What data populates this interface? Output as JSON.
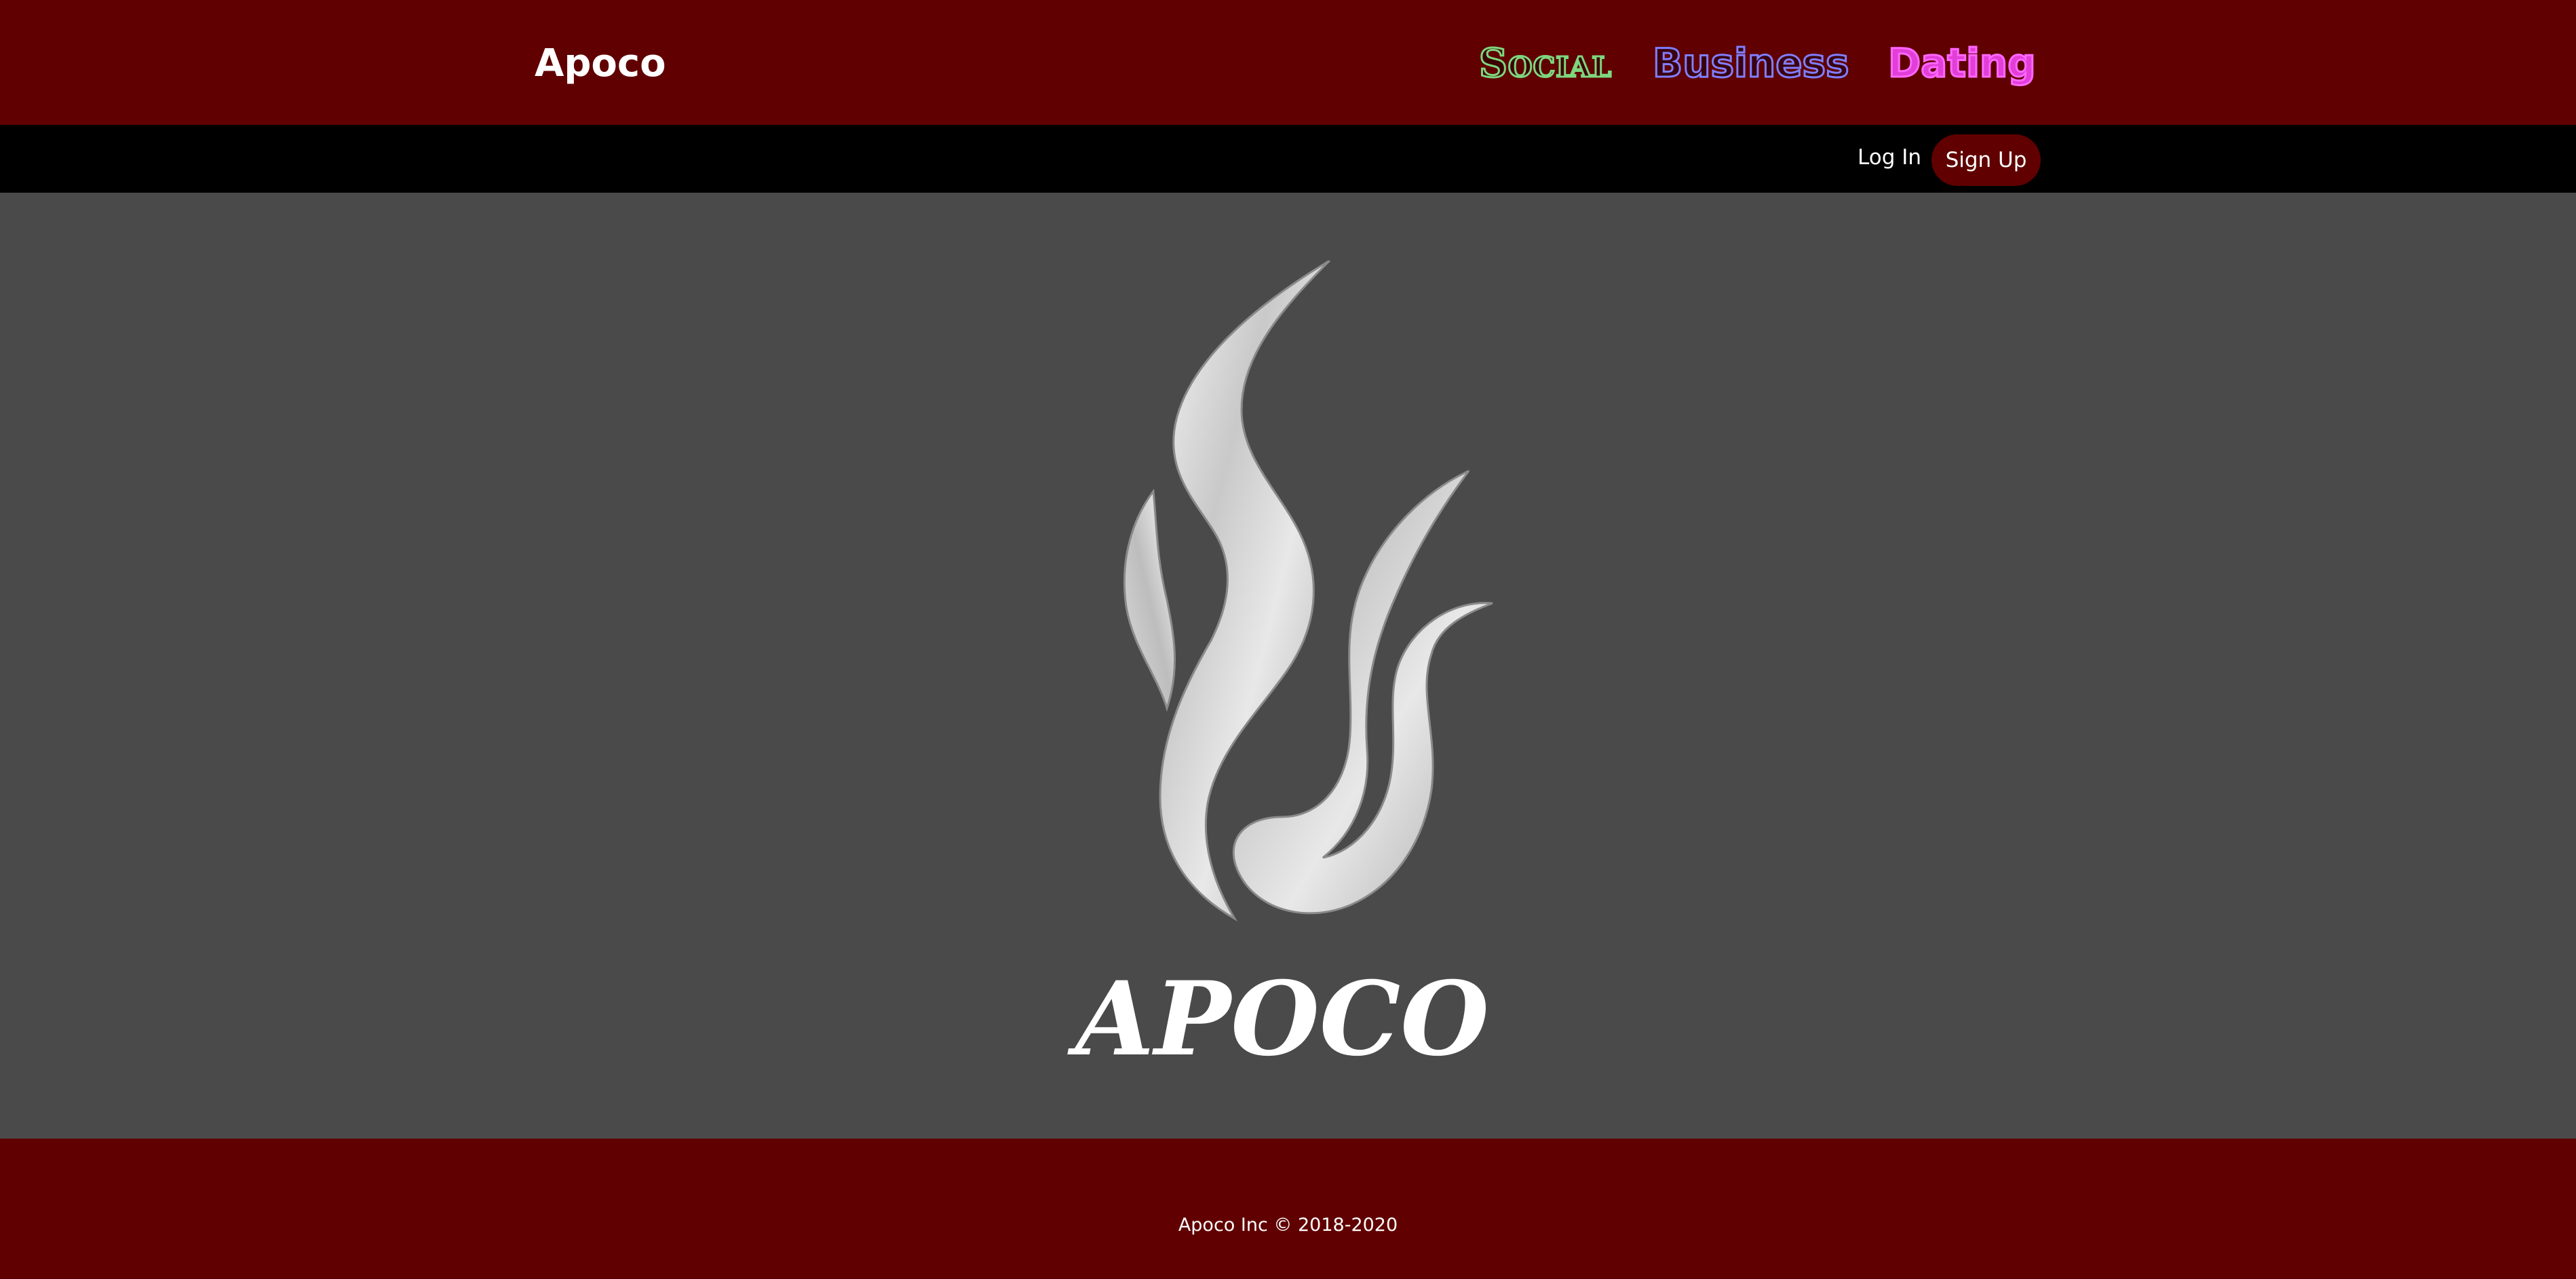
{
  "header": {
    "brand": "Apoco",
    "nav": {
      "social": "Social",
      "business": "Business",
      "dating": "Dating"
    }
  },
  "auth": {
    "login_label": "Log In",
    "signup_label": "Sign Up"
  },
  "hero": {
    "logo_icon": "apoco-flame-logo",
    "logo_wordmark": "APOCO"
  },
  "footer": {
    "copyright": "Apoco Inc © 2018-2020"
  },
  "colors": {
    "brand_red": "#600000",
    "auth_bar": "#000000",
    "content_bg": "#4a4a4a",
    "social_outline": "#7ed67e",
    "business_outline": "#7f7fff",
    "dating_fill": "#e23fd8"
  }
}
